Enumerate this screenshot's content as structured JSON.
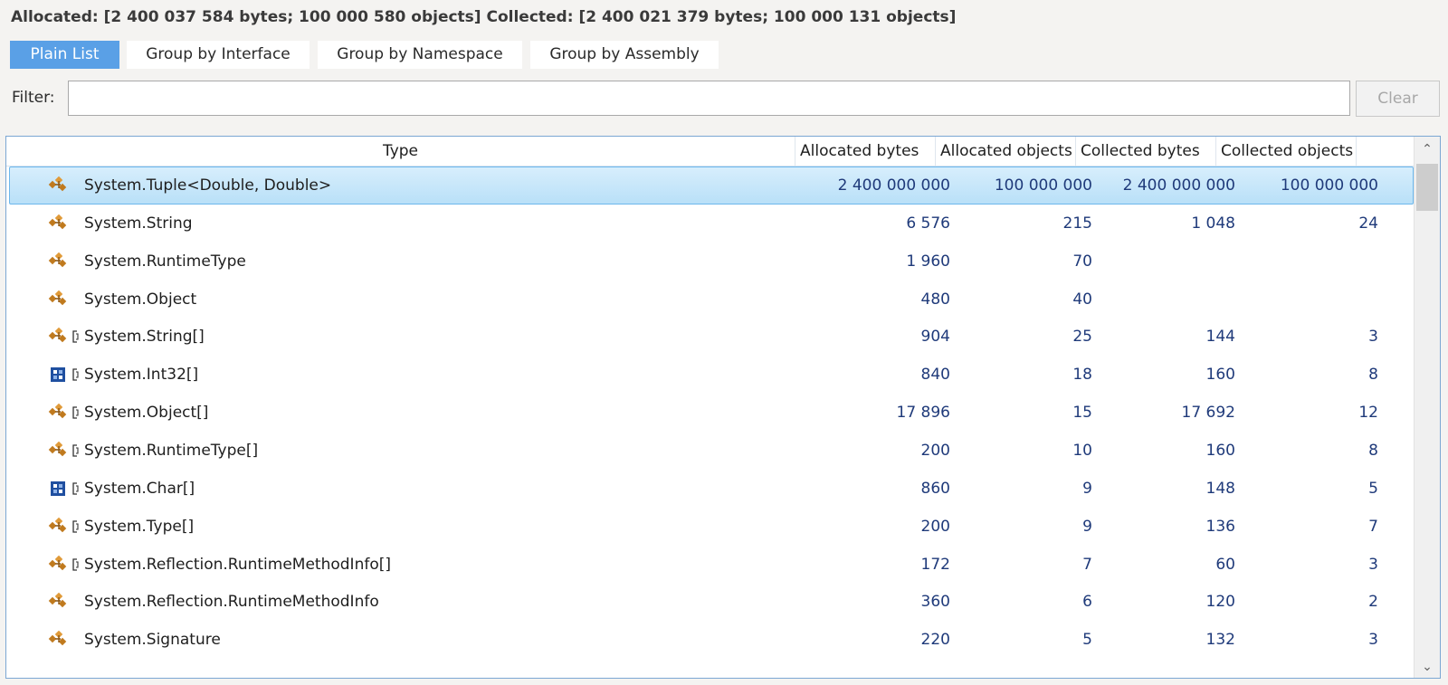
{
  "summary": "Allocated: [2 400 037 584 bytes; 100 000 580 objects] Collected: [2 400 021 379 bytes; 100 000 131 objects]",
  "tabs": [
    {
      "label": "Plain List",
      "active": true
    },
    {
      "label": "Group by Interface",
      "active": false
    },
    {
      "label": "Group by Namespace",
      "active": false
    },
    {
      "label": "Group by Assembly",
      "active": false
    }
  ],
  "filter": {
    "label": "Filter:",
    "value": "",
    "placeholder": ""
  },
  "clear_label": "Clear",
  "columns": [
    "Type",
    "Allocated bytes",
    "Allocated objects",
    "Collected bytes",
    "Collected objects"
  ],
  "rows": [
    {
      "icon": "class-icon",
      "array": false,
      "name": "System.Tuple<Double, Double>",
      "alloc_bytes": "2 400 000 000",
      "alloc_objects": "100 000 000",
      "coll_bytes": "2 400 000 000",
      "coll_objects": "100 000 000",
      "selected": true
    },
    {
      "icon": "class-icon",
      "array": false,
      "name": "System.String",
      "alloc_bytes": "6 576",
      "alloc_objects": "215",
      "coll_bytes": "1 048",
      "coll_objects": "24"
    },
    {
      "icon": "class-icon",
      "array": false,
      "name": "System.RuntimeType",
      "alloc_bytes": "1 960",
      "alloc_objects": "70",
      "coll_bytes": "",
      "coll_objects": ""
    },
    {
      "icon": "class-icon",
      "array": false,
      "name": "System.Object",
      "alloc_bytes": "480",
      "alloc_objects": "40",
      "coll_bytes": "",
      "coll_objects": ""
    },
    {
      "icon": "class-icon",
      "array": true,
      "name": "System.String[]",
      "alloc_bytes": "904",
      "alloc_objects": "25",
      "coll_bytes": "144",
      "coll_objects": "3"
    },
    {
      "icon": "struct-icon",
      "array": true,
      "name": "System.Int32[]",
      "alloc_bytes": "840",
      "alloc_objects": "18",
      "coll_bytes": "160",
      "coll_objects": "8"
    },
    {
      "icon": "class-icon",
      "array": true,
      "name": "System.Object[]",
      "alloc_bytes": "17 896",
      "alloc_objects": "15",
      "coll_bytes": "17 692",
      "coll_objects": "12"
    },
    {
      "icon": "class-icon",
      "array": true,
      "name": "System.RuntimeType[]",
      "alloc_bytes": "200",
      "alloc_objects": "10",
      "coll_bytes": "160",
      "coll_objects": "8"
    },
    {
      "icon": "struct-icon",
      "array": true,
      "name": "System.Char[]",
      "alloc_bytes": "860",
      "alloc_objects": "9",
      "coll_bytes": "148",
      "coll_objects": "5"
    },
    {
      "icon": "class-icon",
      "array": true,
      "name": "System.Type[]",
      "alloc_bytes": "200",
      "alloc_objects": "9",
      "coll_bytes": "136",
      "coll_objects": "7"
    },
    {
      "icon": "class-icon",
      "array": true,
      "name": "System.Reflection.RuntimeMethodInfo[]",
      "alloc_bytes": "172",
      "alloc_objects": "7",
      "coll_bytes": "60",
      "coll_objects": "3"
    },
    {
      "icon": "class-icon",
      "array": false,
      "name": "System.Reflection.RuntimeMethodInfo",
      "alloc_bytes": "360",
      "alloc_objects": "6",
      "coll_bytes": "120",
      "coll_objects": "2"
    },
    {
      "icon": "class-icon",
      "array": false,
      "name": "System.Signature",
      "alloc_bytes": "220",
      "alloc_objects": "5",
      "coll_bytes": "132",
      "coll_objects": "3"
    }
  ],
  "colors": {
    "accent": "#5aa0e6",
    "class_icon": "#c07a1e",
    "struct_icon": "#1f4fa0",
    "numbers": "#1f3a7a"
  }
}
